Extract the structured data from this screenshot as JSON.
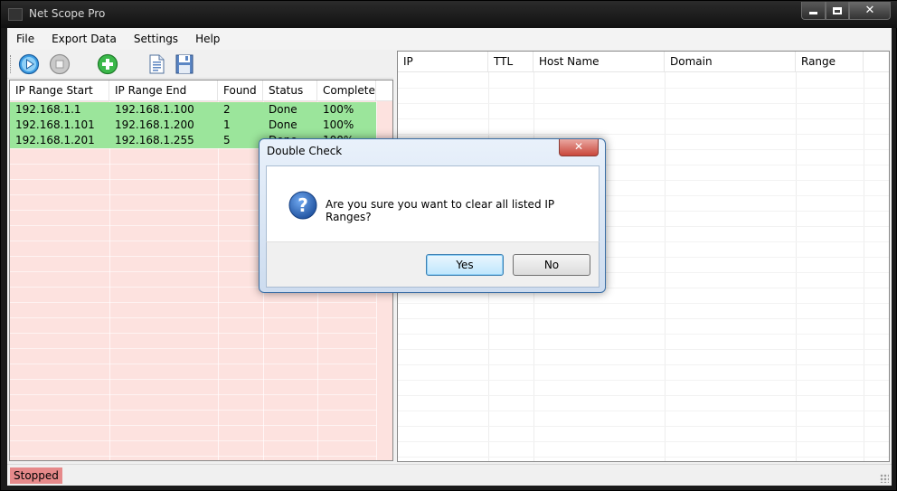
{
  "window": {
    "title": "Net Scope Pro"
  },
  "menu": [
    "File",
    "Export Data",
    "Settings",
    "Help"
  ],
  "toolbar": {
    "buttons": [
      {
        "name": "start-scan-icon"
      },
      {
        "name": "stop-scan-icon"
      },
      {
        "name": "add-range-icon"
      },
      {
        "name": "document-icon"
      },
      {
        "name": "save-icon"
      }
    ]
  },
  "ranges_table": {
    "columns": [
      "IP Range Start",
      "IP Range End",
      "Found",
      "Status",
      "Completed"
    ],
    "rows": [
      [
        "192.168.1.1",
        "192.168.1.100",
        "2",
        "Done",
        "100%"
      ],
      [
        "192.168.1.101",
        "192.168.1.200",
        "1",
        "Done",
        "100%"
      ],
      [
        "192.168.1.201",
        "192.168.1.255",
        "5",
        "Done",
        "100%"
      ]
    ],
    "row_color": "#9be59b",
    "bg_color": "#fde2df"
  },
  "results_table": {
    "columns": [
      "IP",
      "TTL",
      "Host Name",
      "Domain",
      "Range"
    ]
  },
  "status": {
    "text": "Stopped",
    "color": "#e6898a"
  },
  "dialog": {
    "title": "Double Check",
    "close_label": "✕",
    "icon": "question-icon",
    "message": "Are you sure you want to clear all listed IP Ranges?",
    "yes_label": "Yes",
    "no_label": "No"
  }
}
